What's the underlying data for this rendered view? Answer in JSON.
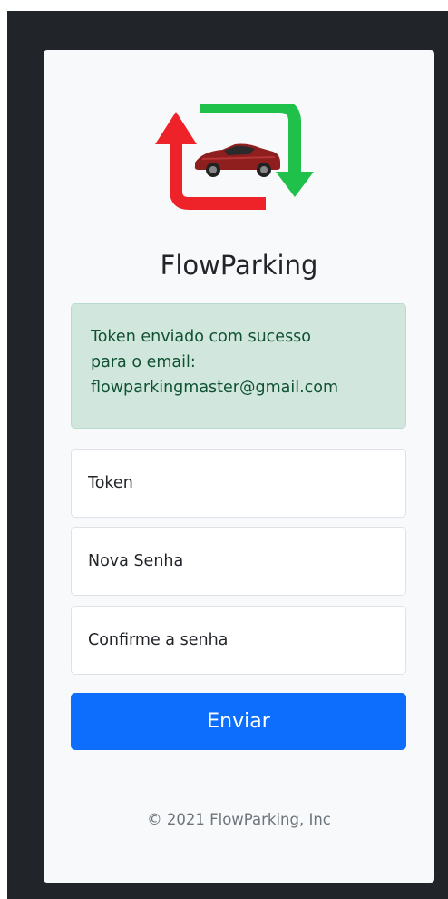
{
  "brand": {
    "name": "FlowParking",
    "logo_icon": "sync-arrows-car-icon"
  },
  "alert": {
    "line1": "Token enviado com sucesso",
    "line2": "para o email:",
    "line3": "flowparkingmaster@gmail.com"
  },
  "form": {
    "token_placeholder": "Token",
    "new_password_placeholder": "Nova Senha",
    "confirm_password_placeholder": "Confirme a senha",
    "submit_label": "Enviar"
  },
  "footer": {
    "copyright": "© 2021 FlowParking, Inc"
  },
  "colors": {
    "primary": "#0d6efd",
    "alert_bg": "#d1e7dd",
    "alert_text": "#0f5132",
    "arrow_red": "#ee2229",
    "arrow_green": "#1fc14a",
    "frame_bg": "#212529",
    "card_bg": "#f8f9fa"
  }
}
